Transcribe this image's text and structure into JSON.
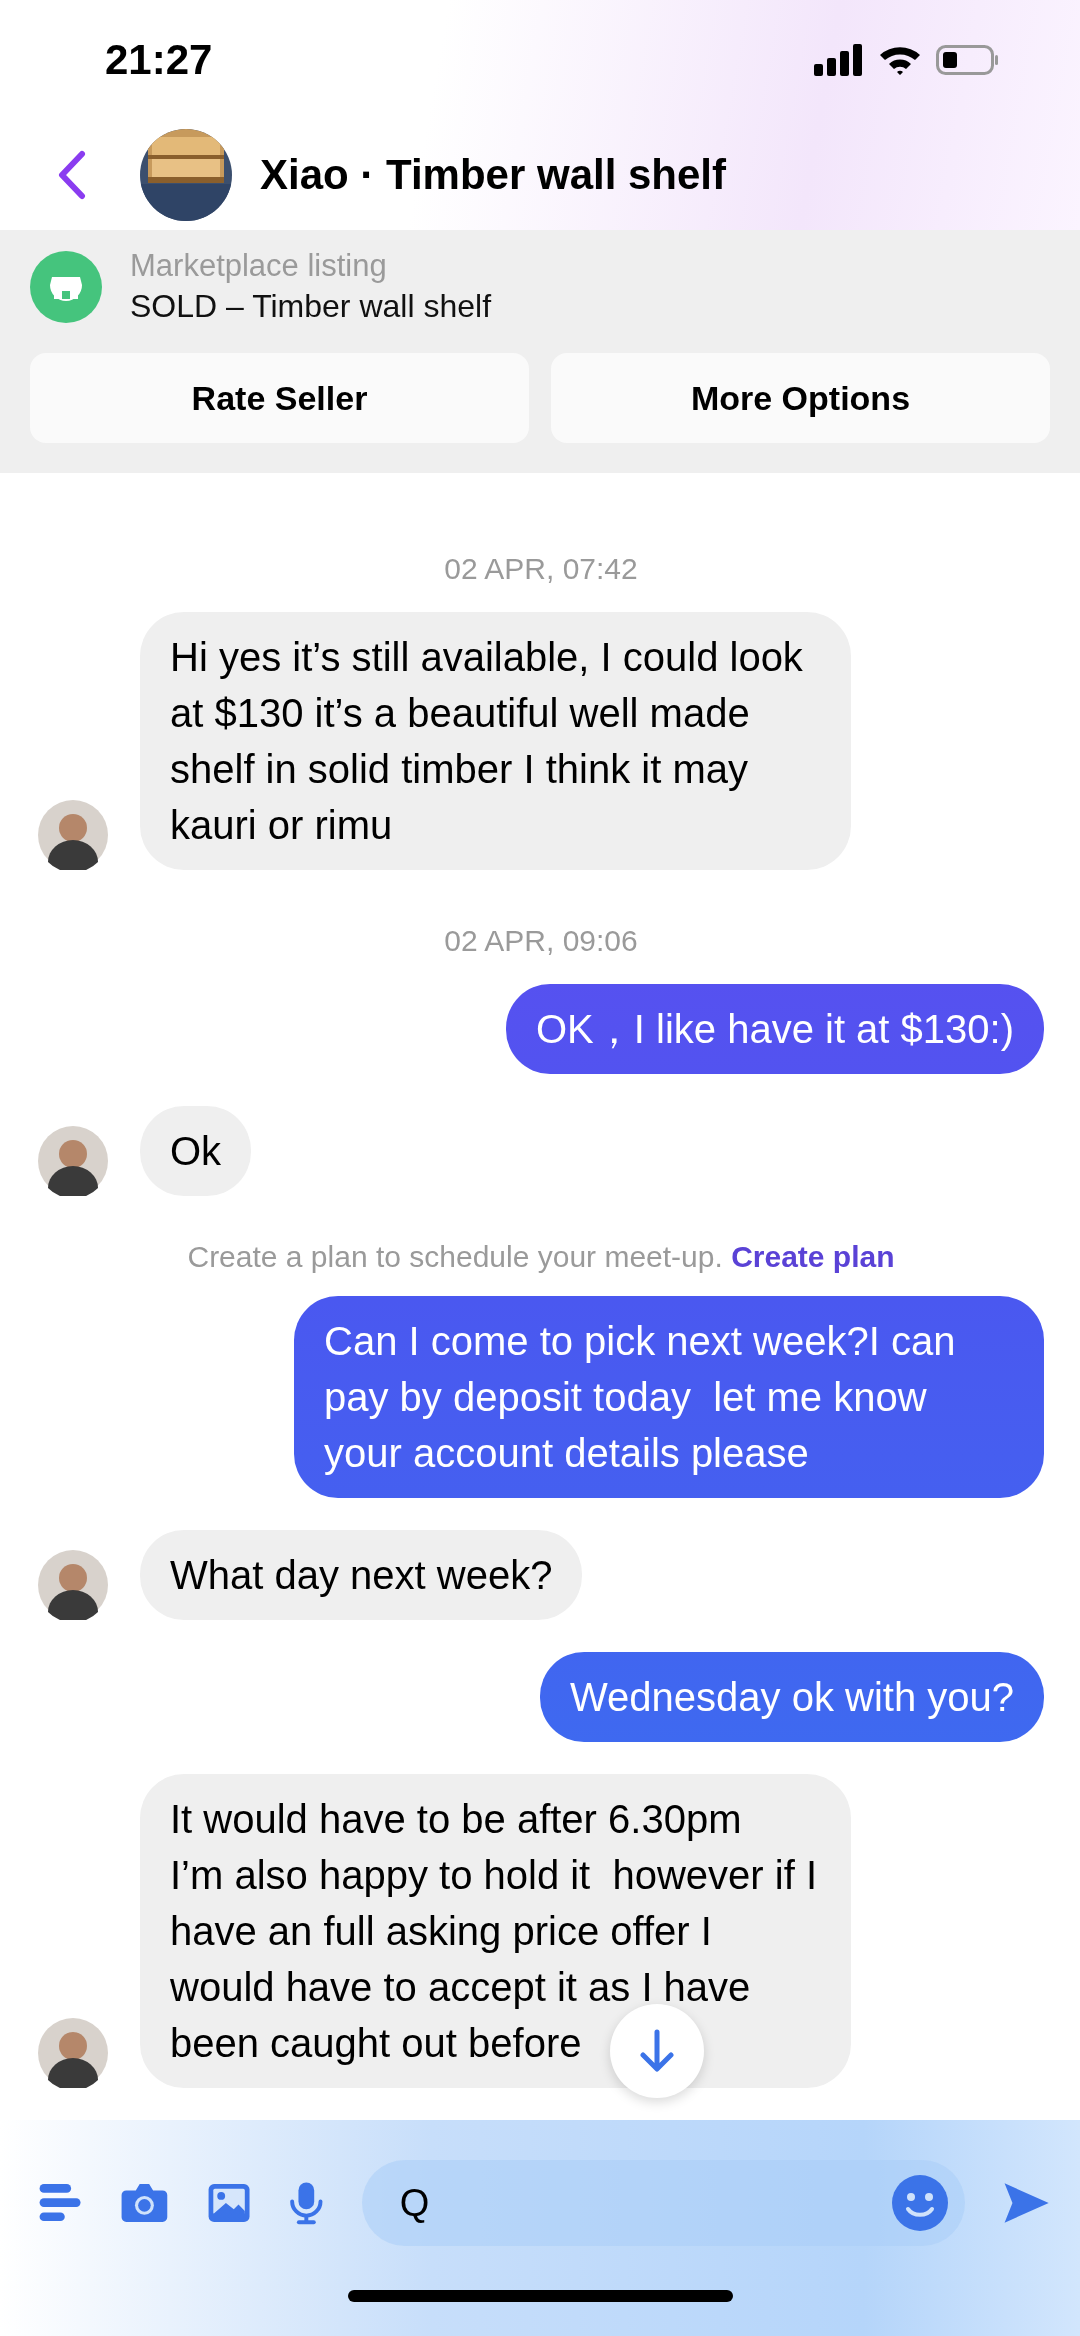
{
  "status_bar": {
    "time": "21:27"
  },
  "header": {
    "title": "Xiao · Timber wall shelf"
  },
  "listing": {
    "caption": "Marketplace listing",
    "title": "SOLD – Timber wall shelf",
    "buttons": [
      "Rate Seller",
      "More Options"
    ]
  },
  "messages": [
    {
      "kind": "date",
      "text": "02 APR, 07:42"
    },
    {
      "kind": "incoming",
      "text": "Hi yes it’s still available, I could look at $130 it’s a beautiful well made shelf in solid timber I think it may kauri or rimu"
    },
    {
      "kind": "date",
      "text": "02 APR, 09:06"
    },
    {
      "kind": "outgoing",
      "text": "OK，I like have it at $130:)"
    },
    {
      "kind": "incoming",
      "text": "Ok"
    },
    {
      "kind": "notice",
      "text": "Create a plan to schedule your meet-up.",
      "link": "Create plan"
    },
    {
      "kind": "outgoing",
      "text": "Can I come to pick next week?I can pay by deposit today  let me know your account details please"
    },
    {
      "kind": "incoming",
      "text": "What day next week?"
    },
    {
      "kind": "outgoing",
      "text": "Wednesday ok with you?"
    },
    {
      "kind": "incoming",
      "text": "It would have to be after 6.30pm\nI’m also happy to hold it  however if I have an full asking price offer I would have to accept it as I have been caught out before"
    }
  ],
  "composer": {
    "value": "Q"
  }
}
